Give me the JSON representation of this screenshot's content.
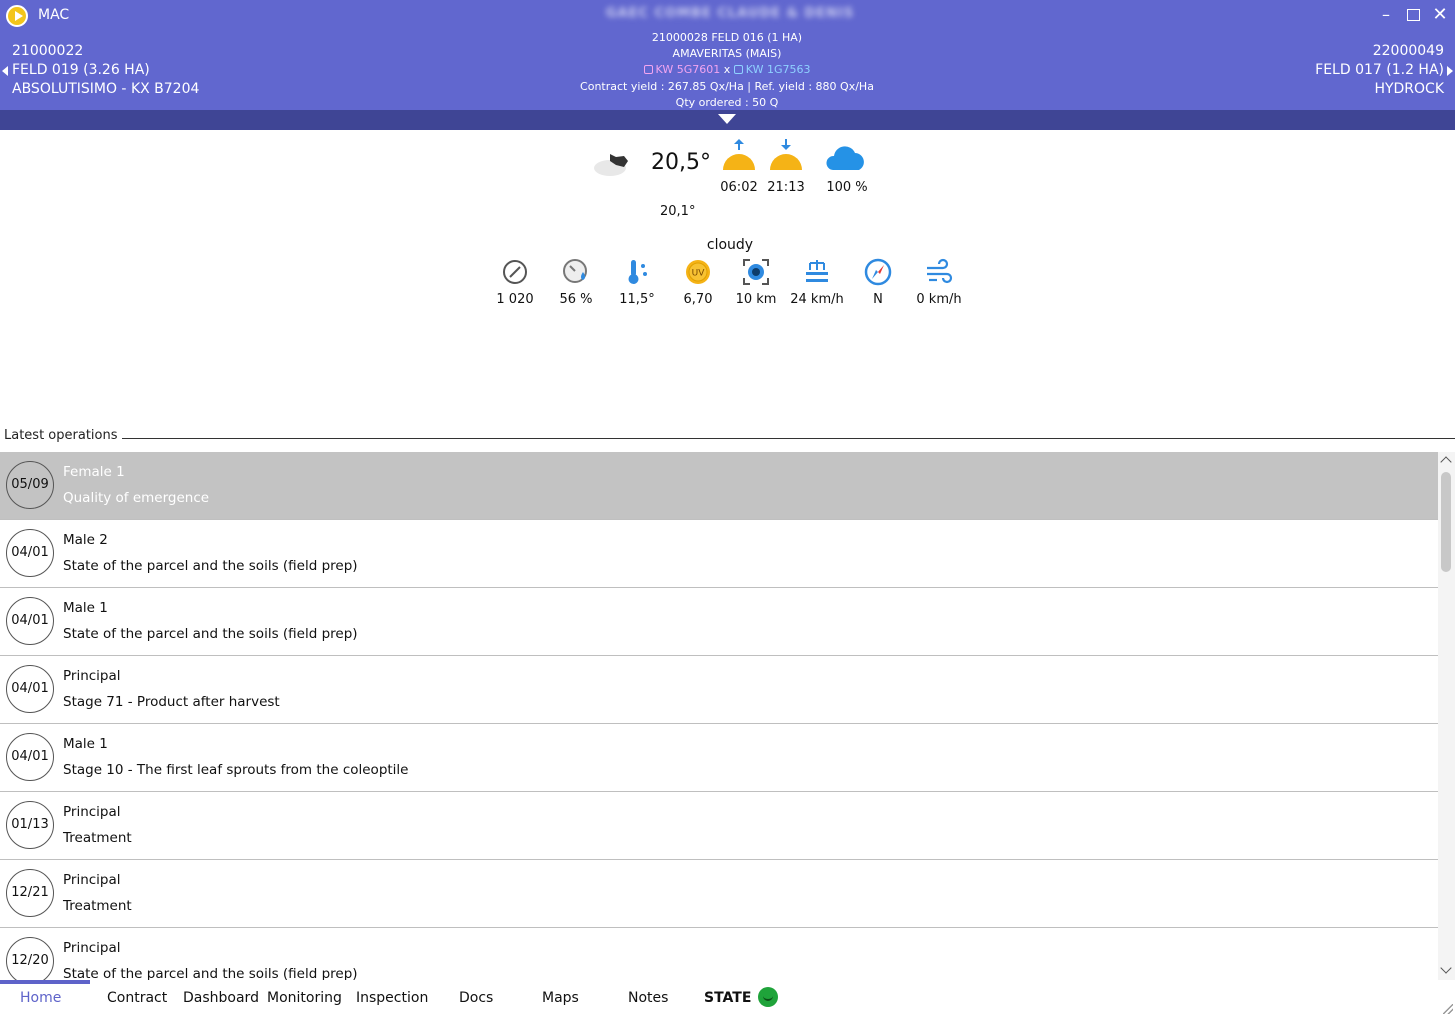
{
  "app": {
    "name": "MAC",
    "window_title": "GAEC COMBE CLAUDE & DENIS"
  },
  "header": {
    "prev": {
      "code": "21000022",
      "field": "FELD 019 (3.26 HA)",
      "variety": "ABSOLUTISIMO - KX B7204"
    },
    "current": {
      "line1": "21000028 FELD 016 (1 HA)",
      "line2": "AMAVERITAS (MAIS)",
      "variety_a": "KW 5G7601",
      "cross": "x",
      "variety_b": "KW 1G7563",
      "yield_line": "Contract yield : 267.85 Qx/Ha  |  Ref. yield : 880 Qx/Ha",
      "qty_line": "Qty ordered : 50 Q"
    },
    "next": {
      "code": "22000049",
      "field": "FELD 017 (1.2 HA)",
      "variety": "HYDROCK"
    }
  },
  "weather": {
    "temperature": "20,5°",
    "feels_like": "20,1°",
    "sunrise": "06:02",
    "sunset": "21:13",
    "cloud_cover": "100 %",
    "description": "cloudy",
    "metrics": [
      {
        "icon": "pressure-gauge-icon",
        "value": "1 020"
      },
      {
        "icon": "humidity-gauge-icon",
        "value": "56 %"
      },
      {
        "icon": "dew-point-icon",
        "value": "11,5°"
      },
      {
        "icon": "uv-index-icon",
        "value": "6,70"
      },
      {
        "icon": "visibility-eye-icon",
        "value": "10 km"
      },
      {
        "icon": "wind-gust-icon",
        "value": "24 km/h"
      },
      {
        "icon": "compass-icon",
        "value": "N"
      },
      {
        "icon": "wind-icon",
        "value": "0 km/h"
      }
    ]
  },
  "operations": {
    "label": "Latest operations",
    "items": [
      {
        "date": "05/09",
        "title": "Female 1",
        "desc": "Quality of emergence"
      },
      {
        "date": "04/01",
        "title": "Male 2",
        "desc": "State of the parcel and the soils (field prep)"
      },
      {
        "date": "04/01",
        "title": "Male 1",
        "desc": "State of the parcel and the soils (field prep)"
      },
      {
        "date": "04/01",
        "title": "Principal",
        "desc": "Stage 71 - Product after harvest"
      },
      {
        "date": "04/01",
        "title": "Male 1",
        "desc": "Stage 10 - The first leaf sprouts from the coleoptile"
      },
      {
        "date": "01/13",
        "title": "Principal",
        "desc": "Treatment"
      },
      {
        "date": "12/21",
        "title": "Principal",
        "desc": "Treatment"
      },
      {
        "date": "12/20",
        "title": "Principal",
        "desc": "State of the parcel and the soils (field prep)"
      }
    ]
  },
  "tabs": [
    "Home",
    "Contract",
    "Dashboard",
    "Monitoring",
    "Inspection",
    "Docs",
    "Maps",
    "Notes",
    "STATE"
  ],
  "colors": {
    "header": "#6167cf",
    "subbar": "#3f4595",
    "accent": "#5e63c9",
    "selected_row": "#c3c3c3",
    "state_ok": "#1fa33a"
  }
}
